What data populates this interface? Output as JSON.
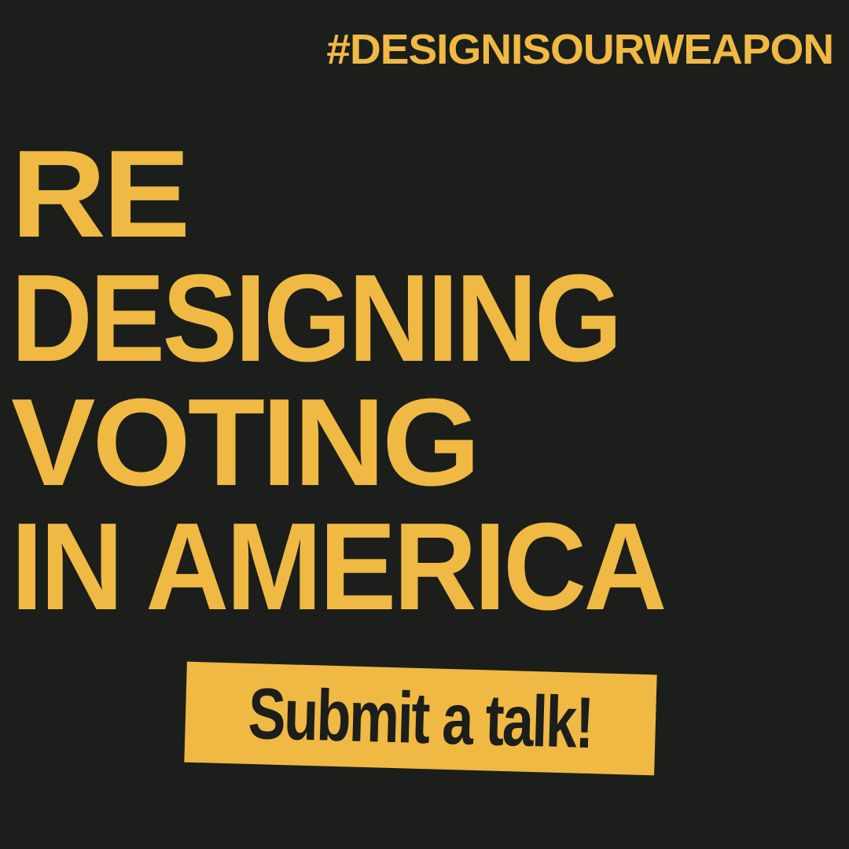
{
  "colors": {
    "background": "#1b1e1b",
    "accent": "#f0b944"
  },
  "hashtag": "#DESIGNISOURWEAPON",
  "headline": {
    "line1": "RE",
    "line2": "DESIGNING",
    "line3": "VOTING",
    "line4": "IN AMERICA"
  },
  "cta": {
    "label": "Submit a talk!"
  }
}
